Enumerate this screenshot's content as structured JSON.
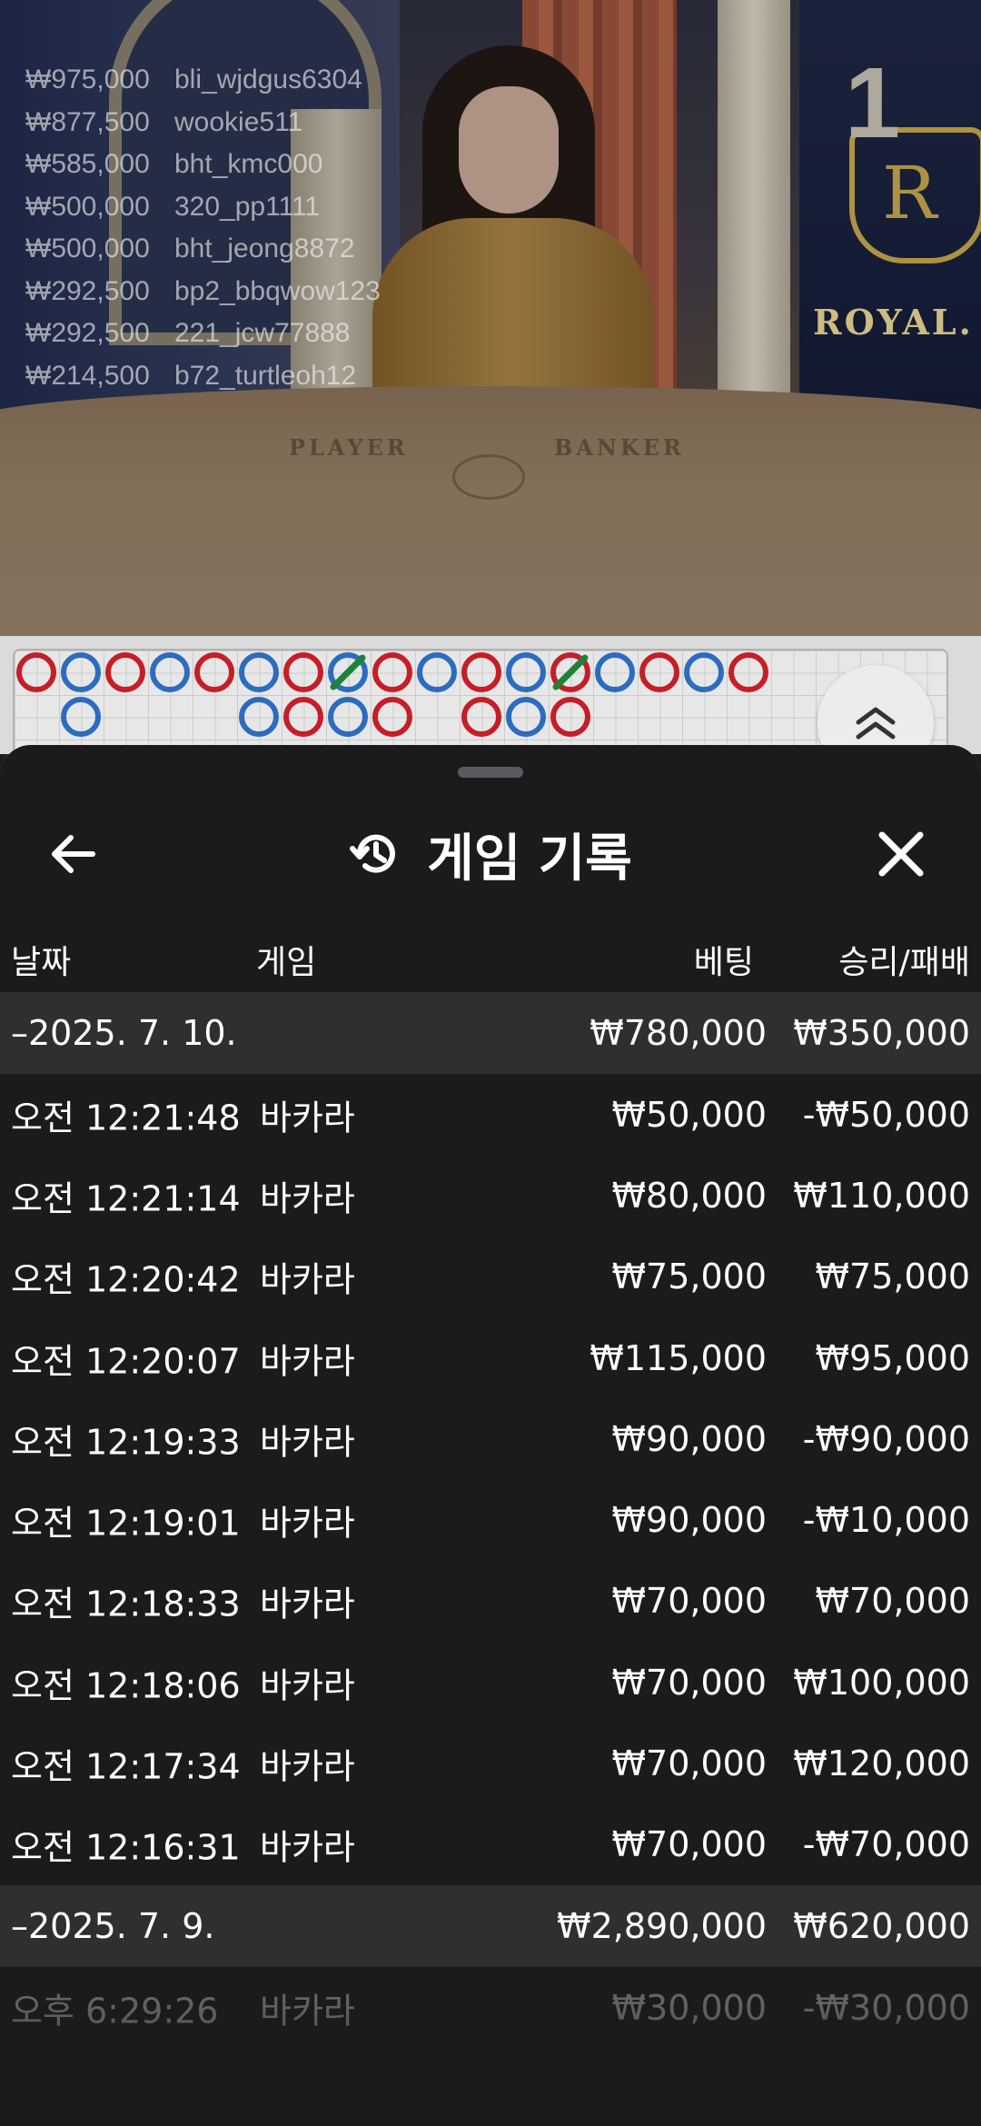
{
  "video": {
    "round_number": "1",
    "brand_text": "ROYAL.",
    "table_labels": {
      "player": "PLAYER",
      "banker": "BANKER"
    },
    "crest_letter": "R"
  },
  "ranking": [
    {
      "amount": "₩975,000",
      "user": "bli_wjdgus6304"
    },
    {
      "amount": "₩877,500",
      "user": "wookie511"
    },
    {
      "amount": "₩585,000",
      "user": "bht_kmc000"
    },
    {
      "amount": "₩500,000",
      "user": "320_pp1111"
    },
    {
      "amount": "₩500,000",
      "user": "bht_jeong8872"
    },
    {
      "amount": "₩292,500",
      "user": "bp2_bbqwow123"
    },
    {
      "amount": "₩292,500",
      "user": "221_jcw77888"
    },
    {
      "amount": "₩214,500",
      "user": "b72_turtleoh12"
    }
  ],
  "roadmap": {
    "colors": {
      "banker": "#d0202a",
      "player": "#2f72c9",
      "tie": "#1f8a3a"
    },
    "cells": [
      {
        "col": 0,
        "row": 0,
        "s": "B"
      },
      {
        "col": 1,
        "row": 0,
        "s": "P"
      },
      {
        "col": 1,
        "row": 1,
        "s": "P"
      },
      {
        "col": 2,
        "row": 0,
        "s": "B"
      },
      {
        "col": 3,
        "row": 0,
        "s": "P"
      },
      {
        "col": 4,
        "row": 0,
        "s": "B"
      },
      {
        "col": 5,
        "row": 0,
        "s": "P"
      },
      {
        "col": 5,
        "row": 1,
        "s": "P"
      },
      {
        "col": 6,
        "row": 0,
        "s": "B"
      },
      {
        "col": 6,
        "row": 1,
        "s": "B"
      },
      {
        "col": 7,
        "row": 0,
        "s": "P",
        "tie": true
      },
      {
        "col": 7,
        "row": 1,
        "s": "P"
      },
      {
        "col": 8,
        "row": 0,
        "s": "B"
      },
      {
        "col": 8,
        "row": 1,
        "s": "B"
      },
      {
        "col": 9,
        "row": 0,
        "s": "P"
      },
      {
        "col": 10,
        "row": 0,
        "s": "B"
      },
      {
        "col": 10,
        "row": 1,
        "s": "B"
      },
      {
        "col": 11,
        "row": 0,
        "s": "P"
      },
      {
        "col": 11,
        "row": 1,
        "s": "P"
      },
      {
        "col": 12,
        "row": 0,
        "s": "B",
        "tie": true
      },
      {
        "col": 12,
        "row": 1,
        "s": "B"
      },
      {
        "col": 13,
        "row": 0,
        "s": "P"
      },
      {
        "col": 14,
        "row": 0,
        "s": "B"
      },
      {
        "col": 15,
        "row": 0,
        "s": "P"
      },
      {
        "col": 16,
        "row": 0,
        "s": "B"
      }
    ]
  },
  "sheet": {
    "title": "게임 기록",
    "icons": {
      "back": "arrow-left-icon",
      "history": "history-icon",
      "close": "close-icon",
      "expand": "chevron-up-double-icon"
    },
    "columns": {
      "date": "날짜",
      "game": "게임",
      "bet": "베팅",
      "result": "승리/패배"
    },
    "groups": [
      {
        "date": "–2025. 7. 10.",
        "bet_total": "₩780,000",
        "result_total": "₩350,000",
        "rows": [
          {
            "time": "오전 12:21:48",
            "game": "바카라",
            "bet": "₩50,000",
            "result": "-₩50,000"
          },
          {
            "time": "오전 12:21:14",
            "game": "바카라",
            "bet": "₩80,000",
            "result": "₩110,000"
          },
          {
            "time": "오전 12:20:42",
            "game": "바카라",
            "bet": "₩75,000",
            "result": "₩75,000"
          },
          {
            "time": "오전 12:20:07",
            "game": "바카라",
            "bet": "₩115,000",
            "result": "₩95,000"
          },
          {
            "time": "오전 12:19:33",
            "game": "바카라",
            "bet": "₩90,000",
            "result": "-₩90,000"
          },
          {
            "time": "오전 12:19:01",
            "game": "바카라",
            "bet": "₩90,000",
            "result": "-₩10,000"
          },
          {
            "time": "오전 12:18:33",
            "game": "바카라",
            "bet": "₩70,000",
            "result": "₩70,000"
          },
          {
            "time": "오전 12:18:06",
            "game": "바카라",
            "bet": "₩70,000",
            "result": "₩100,000"
          },
          {
            "time": "오전 12:17:34",
            "game": "바카라",
            "bet": "₩70,000",
            "result": "₩120,000"
          },
          {
            "time": "오전 12:16:31",
            "game": "바카라",
            "bet": "₩70,000",
            "result": "-₩70,000"
          }
        ]
      },
      {
        "date": "–2025. 7. 9.",
        "bet_total": "₩2,890,000",
        "result_total": "₩620,000",
        "rows": [
          {
            "time": "오후 6:29:26",
            "game": "바카라",
            "bet": "₩30,000",
            "result": "-₩30,000"
          }
        ]
      }
    ]
  }
}
